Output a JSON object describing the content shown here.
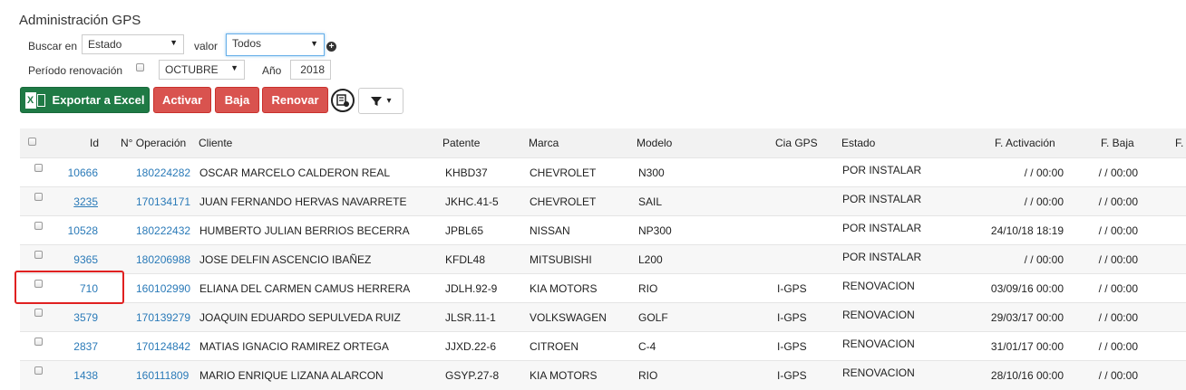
{
  "page": {
    "title": "Administración GPS"
  },
  "search": {
    "buscar_label": "Buscar en",
    "buscar_value": "Estado",
    "valor_label": "valor",
    "valor_value": "Todos",
    "periodo_label": "Período renovación",
    "month_value": "OCTUBRE",
    "anio_label": "Año",
    "anio_value": "2018"
  },
  "toolbar": {
    "export_label": "Exportar a Excel",
    "activar_label": "Activar",
    "baja_label": "Baja",
    "renovar_label": "Renovar"
  },
  "colors": {
    "green": "#1f7a45",
    "red": "#d9534f",
    "link": "#2a7ab8",
    "highlight": "#e02020"
  },
  "table": {
    "headers": [
      "Id",
      "N° Operación",
      "Cliente",
      "Patente",
      "Marca",
      "Modelo",
      "Cia GPS",
      "Estado",
      "F. Activación",
      "F. Baja",
      "F."
    ],
    "rows": [
      {
        "id": "10666",
        "op": "180224282",
        "cliente": "OSCAR MARCELO CALDERON REAL",
        "patente": "KHBD37",
        "marca": "CHEVROLET",
        "modelo": "N300",
        "cia": "",
        "estado": "POR INSTALAR",
        "factivacion": "/ / 00:00",
        "fbaja": "/ / 00:00"
      },
      {
        "id": "3235",
        "op": "170134171",
        "cliente": "JUAN FERNANDO HERVAS NAVARRETE",
        "patente": "JKHC.41-5",
        "marca": "CHEVROLET",
        "modelo": "SAIL",
        "cia": "",
        "estado": "POR INSTALAR",
        "factivacion": "/ / 00:00",
        "fbaja": "/ / 00:00"
      },
      {
        "id": "10528",
        "op": "180222432",
        "cliente": "HUMBERTO JULIAN BERRIOS BECERRA",
        "patente": "JPBL65",
        "marca": "NISSAN",
        "modelo": "NP300",
        "cia": "",
        "estado": "POR INSTALAR",
        "factivacion": "24/10/18 18:19",
        "fbaja": "/ / 00:00"
      },
      {
        "id": "9365",
        "op": "180206988",
        "cliente": "JOSE DELFIN ASCENCIO IBAÑEZ",
        "patente": "KFDL48",
        "marca": "MITSUBISHI",
        "modelo": "L200",
        "cia": "",
        "estado": "POR INSTALAR",
        "factivacion": "/ / 00:00",
        "fbaja": "/ / 00:00"
      },
      {
        "id": "710",
        "op": "160102990",
        "cliente": "ELIANA DEL CARMEN CAMUS HERRERA",
        "patente": "JDLH.92-9",
        "marca": "KIA MOTORS",
        "modelo": "RIO",
        "cia": "I-GPS",
        "estado": "RENOVACION",
        "factivacion": "03/09/16 00:00",
        "fbaja": "/ / 00:00"
      },
      {
        "id": "3579",
        "op": "170139279",
        "cliente": "JOAQUIN EDUARDO SEPULVEDA RUIZ",
        "patente": "JLSR.11-1",
        "marca": "VOLKSWAGEN",
        "modelo": "GOLF",
        "cia": "I-GPS",
        "estado": "RENOVACION",
        "factivacion": "29/03/17 00:00",
        "fbaja": "/ / 00:00"
      },
      {
        "id": "2837",
        "op": "170124842",
        "cliente": "MATIAS IGNACIO RAMIREZ ORTEGA",
        "patente": "JJXD.22-6",
        "marca": "CITROEN",
        "modelo": "C-4",
        "cia": "I-GPS",
        "estado": "RENOVACION",
        "factivacion": "31/01/17 00:00",
        "fbaja": "/ / 00:00"
      },
      {
        "id": "1438",
        "op": "160111809",
        "cliente": "MARIO ENRIQUE LIZANA ALARCON",
        "patente": "GSYP.27-8",
        "marca": "KIA MOTORS",
        "modelo": "RIO",
        "cia": "I-GPS",
        "estado": "RENOVACION",
        "factivacion": "28/10/16 00:00",
        "fbaja": "/ / 00:00"
      }
    ]
  }
}
